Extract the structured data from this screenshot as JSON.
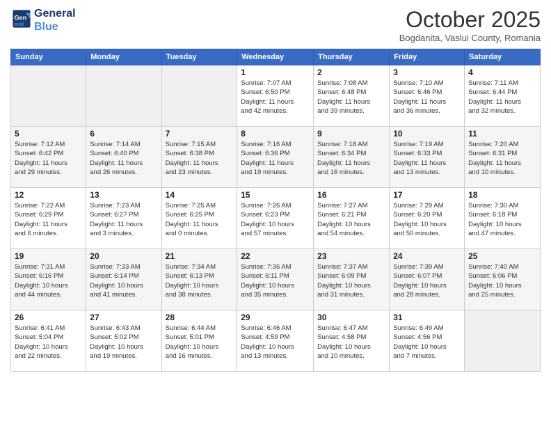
{
  "header": {
    "logo_line1": "General",
    "logo_line2": "Blue",
    "month": "October 2025",
    "location": "Bogdanita, Vaslui County, Romania"
  },
  "weekdays": [
    "Sunday",
    "Monday",
    "Tuesday",
    "Wednesday",
    "Thursday",
    "Friday",
    "Saturday"
  ],
  "weeks": [
    [
      {
        "day": "",
        "info": ""
      },
      {
        "day": "",
        "info": ""
      },
      {
        "day": "",
        "info": ""
      },
      {
        "day": "1",
        "info": "Sunrise: 7:07 AM\nSunset: 6:50 PM\nDaylight: 11 hours\nand 42 minutes."
      },
      {
        "day": "2",
        "info": "Sunrise: 7:08 AM\nSunset: 6:48 PM\nDaylight: 11 hours\nand 39 minutes."
      },
      {
        "day": "3",
        "info": "Sunrise: 7:10 AM\nSunset: 6:46 PM\nDaylight: 11 hours\nand 36 minutes."
      },
      {
        "day": "4",
        "info": "Sunrise: 7:11 AM\nSunset: 6:44 PM\nDaylight: 11 hours\nand 32 minutes."
      }
    ],
    [
      {
        "day": "5",
        "info": "Sunrise: 7:12 AM\nSunset: 6:42 PM\nDaylight: 11 hours\nand 29 minutes."
      },
      {
        "day": "6",
        "info": "Sunrise: 7:14 AM\nSunset: 6:40 PM\nDaylight: 11 hours\nand 26 minutes."
      },
      {
        "day": "7",
        "info": "Sunrise: 7:15 AM\nSunset: 6:38 PM\nDaylight: 11 hours\nand 23 minutes."
      },
      {
        "day": "8",
        "info": "Sunrise: 7:16 AM\nSunset: 6:36 PM\nDaylight: 11 hours\nand 19 minutes."
      },
      {
        "day": "9",
        "info": "Sunrise: 7:18 AM\nSunset: 6:34 PM\nDaylight: 11 hours\nand 16 minutes."
      },
      {
        "day": "10",
        "info": "Sunrise: 7:19 AM\nSunset: 6:33 PM\nDaylight: 11 hours\nand 13 minutes."
      },
      {
        "day": "11",
        "info": "Sunrise: 7:20 AM\nSunset: 6:31 PM\nDaylight: 11 hours\nand 10 minutes."
      }
    ],
    [
      {
        "day": "12",
        "info": "Sunrise: 7:22 AM\nSunset: 6:29 PM\nDaylight: 11 hours\nand 6 minutes."
      },
      {
        "day": "13",
        "info": "Sunrise: 7:23 AM\nSunset: 6:27 PM\nDaylight: 11 hours\nand 3 minutes."
      },
      {
        "day": "14",
        "info": "Sunrise: 7:25 AM\nSunset: 6:25 PM\nDaylight: 11 hours\nand 0 minutes."
      },
      {
        "day": "15",
        "info": "Sunrise: 7:26 AM\nSunset: 6:23 PM\nDaylight: 10 hours\nand 57 minutes."
      },
      {
        "day": "16",
        "info": "Sunrise: 7:27 AM\nSunset: 6:21 PM\nDaylight: 10 hours\nand 54 minutes."
      },
      {
        "day": "17",
        "info": "Sunrise: 7:29 AM\nSunset: 6:20 PM\nDaylight: 10 hours\nand 50 minutes."
      },
      {
        "day": "18",
        "info": "Sunrise: 7:30 AM\nSunset: 6:18 PM\nDaylight: 10 hours\nand 47 minutes."
      }
    ],
    [
      {
        "day": "19",
        "info": "Sunrise: 7:31 AM\nSunset: 6:16 PM\nDaylight: 10 hours\nand 44 minutes."
      },
      {
        "day": "20",
        "info": "Sunrise: 7:33 AM\nSunset: 6:14 PM\nDaylight: 10 hours\nand 41 minutes."
      },
      {
        "day": "21",
        "info": "Sunrise: 7:34 AM\nSunset: 6:13 PM\nDaylight: 10 hours\nand 38 minutes."
      },
      {
        "day": "22",
        "info": "Sunrise: 7:36 AM\nSunset: 6:11 PM\nDaylight: 10 hours\nand 35 minutes."
      },
      {
        "day": "23",
        "info": "Sunrise: 7:37 AM\nSunset: 6:09 PM\nDaylight: 10 hours\nand 31 minutes."
      },
      {
        "day": "24",
        "info": "Sunrise: 7:39 AM\nSunset: 6:07 PM\nDaylight: 10 hours\nand 28 minutes."
      },
      {
        "day": "25",
        "info": "Sunrise: 7:40 AM\nSunset: 6:06 PM\nDaylight: 10 hours\nand 25 minutes."
      }
    ],
    [
      {
        "day": "26",
        "info": "Sunrise: 6:41 AM\nSunset: 5:04 PM\nDaylight: 10 hours\nand 22 minutes."
      },
      {
        "day": "27",
        "info": "Sunrise: 6:43 AM\nSunset: 5:02 PM\nDaylight: 10 hours\nand 19 minutes."
      },
      {
        "day": "28",
        "info": "Sunrise: 6:44 AM\nSunset: 5:01 PM\nDaylight: 10 hours\nand 16 minutes."
      },
      {
        "day": "29",
        "info": "Sunrise: 6:46 AM\nSunset: 4:59 PM\nDaylight: 10 hours\nand 13 minutes."
      },
      {
        "day": "30",
        "info": "Sunrise: 6:47 AM\nSunset: 4:58 PM\nDaylight: 10 hours\nand 10 minutes."
      },
      {
        "day": "31",
        "info": "Sunrise: 6:49 AM\nSunset: 4:56 PM\nDaylight: 10 hours\nand 7 minutes."
      },
      {
        "day": "",
        "info": ""
      }
    ]
  ]
}
